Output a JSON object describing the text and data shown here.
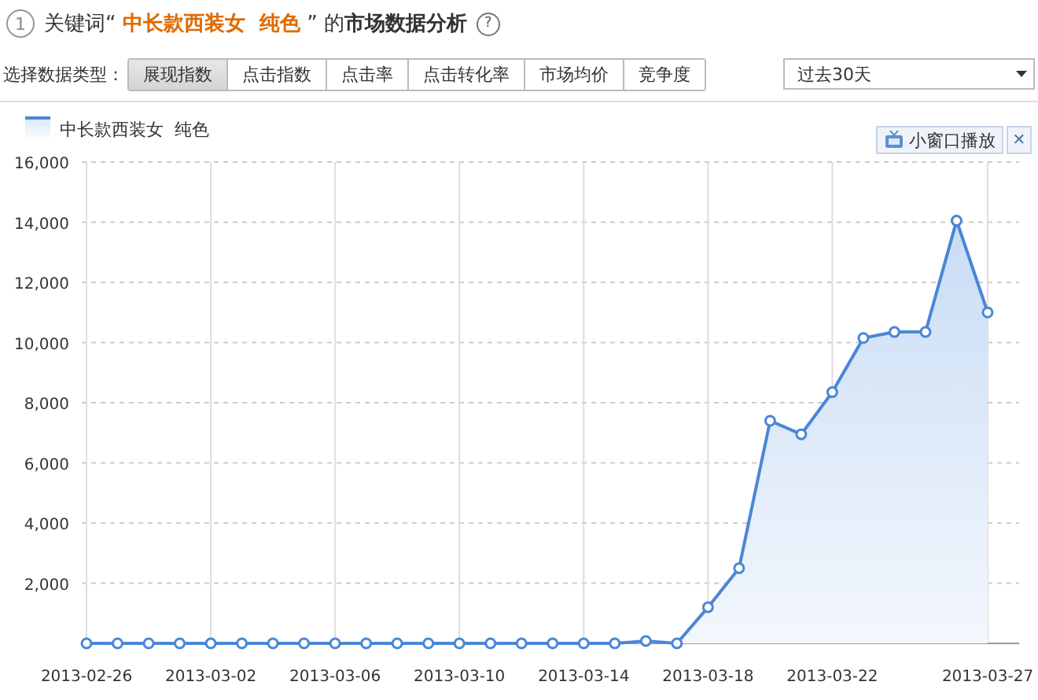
{
  "header": {
    "step": "1",
    "title": "关键词“ **中长款西装女  纯色** ” 的**市场数据分析**",
    "help": "?"
  },
  "toolbar": {
    "label": "选择数据类型：",
    "tabs": [
      {
        "label": "展现指数",
        "selected": true
      },
      {
        "label": "点击指数",
        "selected": false
      },
      {
        "label": "点击率",
        "selected": false
      },
      {
        "label": "点击转化率",
        "selected": false
      },
      {
        "label": "市场均价",
        "selected": false
      },
      {
        "label": "竞争度",
        "selected": false
      }
    ],
    "period": {
      "value": "过去30天"
    }
  },
  "popout": {
    "label": "小窗口播放",
    "close": "✕"
  },
  "chart_data": {
    "type": "area",
    "categories": [
      "2013-02-26",
      null,
      null,
      null,
      "2013-03-02",
      null,
      null,
      null,
      "2013-03-06",
      null,
      null,
      null,
      "2013-03-10",
      null,
      null,
      null,
      "2013-03-14",
      null,
      null,
      null,
      "2013-03-18",
      null,
      null,
      null,
      "2013-03-22",
      null,
      null,
      null,
      null,
      "2013-03-27"
    ],
    "grid": true,
    "series": [
      {
        "name": "中长款西装女  纯色",
        "color": "#4a86d6",
        "values": [
          0,
          0,
          0,
          0,
          0,
          0,
          0,
          0,
          0,
          0,
          0,
          0,
          0,
          0,
          0,
          0,
          0,
          0,
          80,
          0,
          1200,
          2500,
          7400,
          6950,
          8350,
          10150,
          10350,
          10350,
          14050,
          11000
        ]
      }
    ],
    "ylim": [
      0,
      16000
    ],
    "yticks": [
      {
        "value": 2000,
        "label": "2,000"
      },
      {
        "value": 4000,
        "label": "4,000"
      },
      {
        "value": 6000,
        "label": "6,000"
      },
      {
        "value": 8000,
        "label": "8,000"
      },
      {
        "value": 10000,
        "label": "10,000"
      },
      {
        "value": 12000,
        "label": "12,000"
      },
      {
        "value": 14000,
        "label": "14,000"
      },
      {
        "value": 16000,
        "label": "16,000"
      }
    ]
  }
}
